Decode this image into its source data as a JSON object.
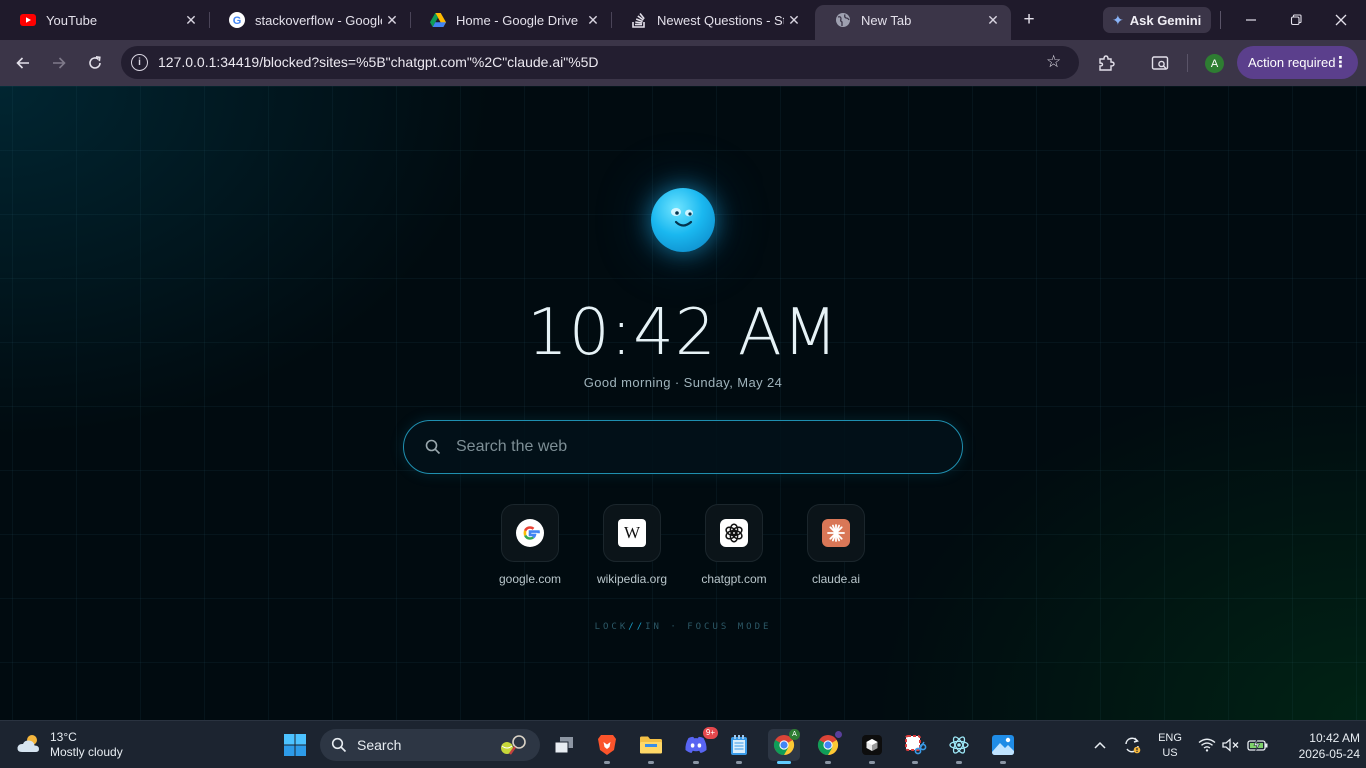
{
  "browser": {
    "tabs": [
      {
        "title": "YouTube",
        "icon": "youtube-icon"
      },
      {
        "title": "stackoverflow - Google Search",
        "icon": "google-icon"
      },
      {
        "title": "Home - Google Drive",
        "icon": "google-drive-icon"
      },
      {
        "title": "Newest Questions - Stack Overflow",
        "icon": "stackoverflow-icon"
      },
      {
        "title": "New Tab",
        "icon": "globe-icon",
        "active": true
      }
    ],
    "new_tab_symbol": "+",
    "ask_gemini_label": "Ask Gemini",
    "url": "127.0.0.1:34419/blocked?sites=%5B\"chatgpt.com\"%2C\"claude.ai\"%5D",
    "profile_initial": "A",
    "action_required_label": "Action required"
  },
  "page": {
    "clock": "10:42 AM",
    "greeting": "Good morning · Sunday, May 24",
    "search_placeholder": "Search the web",
    "shortcuts": [
      {
        "label": "google.com",
        "icon": "google-icon"
      },
      {
        "label": "wikipedia.org",
        "icon": "wikipedia-icon",
        "glyph": "W"
      },
      {
        "label": "chatgpt.com",
        "icon": "chatgpt-icon"
      },
      {
        "label": "claude.ai",
        "icon": "claude-icon"
      }
    ],
    "focus_brand_a": "LOCK",
    "focus_brand_slash": "//",
    "focus_brand_b": "IN · FOCUS MODE"
  },
  "taskbar": {
    "weather_temp": "13°C",
    "weather_desc": "Mostly cloudy",
    "search_label": "Search",
    "discord_badge": "9+",
    "lang_top": "ENG",
    "lang_bottom": "US",
    "time": "10:42 AM",
    "date": "2026-05-24"
  },
  "colors": {
    "accent_cyan": "#1ab8f0",
    "action_purple": "#5b3f8c",
    "taskbar_active": "#60cdff"
  }
}
